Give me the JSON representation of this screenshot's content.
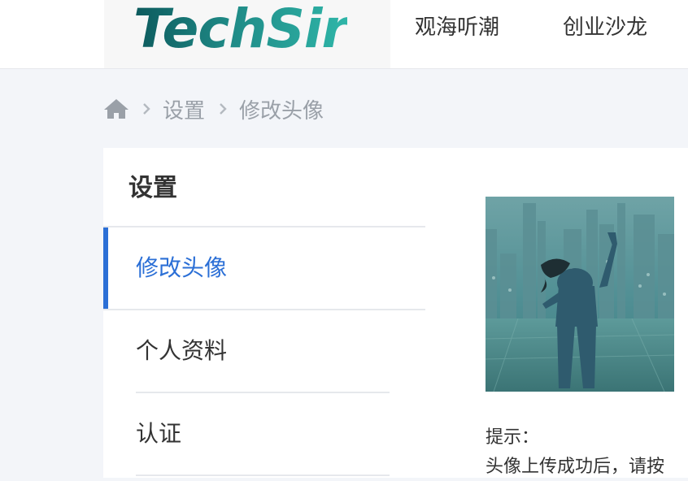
{
  "header": {
    "logo_text": "TechSir",
    "nav": [
      {
        "label": "观海听潮"
      },
      {
        "label": "创业沙龙"
      }
    ]
  },
  "breadcrumb": {
    "home_icon": "home-icon",
    "items": [
      {
        "label": "设置"
      },
      {
        "label": "修改头像"
      }
    ]
  },
  "sidebar": {
    "title": "设置",
    "items": [
      {
        "label": "修改头像",
        "active": true
      },
      {
        "label": "个人资料",
        "active": false
      },
      {
        "label": "认证",
        "active": false
      }
    ]
  },
  "main": {
    "avatar_alt": "avatar",
    "hint_label": "提示：",
    "hint_text": "头像上传成功后，请按"
  },
  "colors": {
    "accent": "#2b6fd6",
    "background": "#f3f5f9",
    "text": "#333333",
    "muted": "#9aa0a8"
  }
}
